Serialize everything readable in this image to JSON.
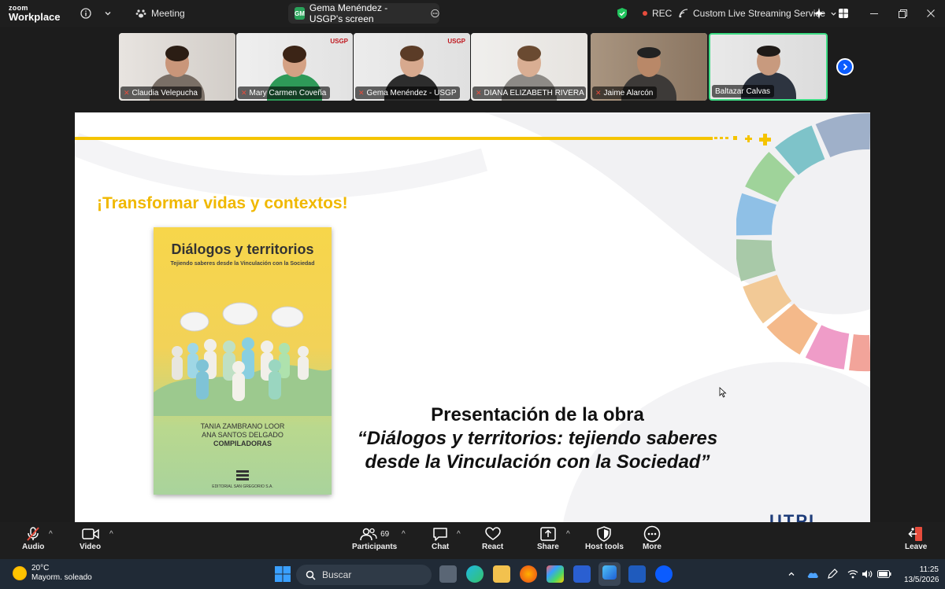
{
  "app": {
    "logo_line1": "zoom",
    "logo_line2": "Workplace",
    "meeting_label": "Meeting"
  },
  "share": {
    "badge": "GM",
    "label": "Gema Menéndez - USGP's screen"
  },
  "status": {
    "rec_label": "REC",
    "streaming_label": "Custom Live Streaming Service"
  },
  "participants_strip": [
    {
      "name": "Claudia Velepucha",
      "badge": ""
    },
    {
      "name": "Mary Carmen Coveña",
      "badge": "USGP"
    },
    {
      "name": "Gema Menéndez - USGP",
      "badge": "USGP"
    },
    {
      "name": "DIANA ELIZABETH RIVERA R...",
      "badge": ""
    },
    {
      "name": "Jaime Alarcón",
      "badge": ""
    },
    {
      "name": "Baltazar Calvas",
      "badge": ""
    }
  ],
  "slide": {
    "tagline": "¡Transformar vidas y contextos!",
    "book": {
      "title": "Diálogos y territorios",
      "subtitle": "Tejiendo saberes desde la Vinculación con la Sociedad",
      "author1": "TANIA ZAMBRANO LOOR",
      "author2": "ANA SANTOS DELGADO",
      "role": "COMPILADORAS",
      "publisher": "EDITORIAL SAN GREGORIO S.A."
    },
    "presentation_line1": "Presentación de la obra",
    "presentation_line2": "“Diálogos y territorios: tejiendo saberes",
    "presentation_line3": "desde la Vinculación con la Sociedad”",
    "logo_text": "UTPL"
  },
  "toolbar": {
    "audio": "Audio",
    "video": "Video",
    "participants": "Participants",
    "participants_count": "69",
    "chat": "Chat",
    "react": "React",
    "share": "Share",
    "host_tools": "Host tools",
    "more": "More",
    "leave": "Leave"
  },
  "taskbar": {
    "temperature": "20°C",
    "weather": "Mayorm. soleado",
    "search_placeholder": "Buscar",
    "time": "11:25",
    "date": "13/5/2026"
  },
  "colors": {
    "accent": "#0b5cff",
    "slide_yellow": "#f5c400",
    "active_speaker": "#3ddc84",
    "rec": "#e74c3c"
  }
}
